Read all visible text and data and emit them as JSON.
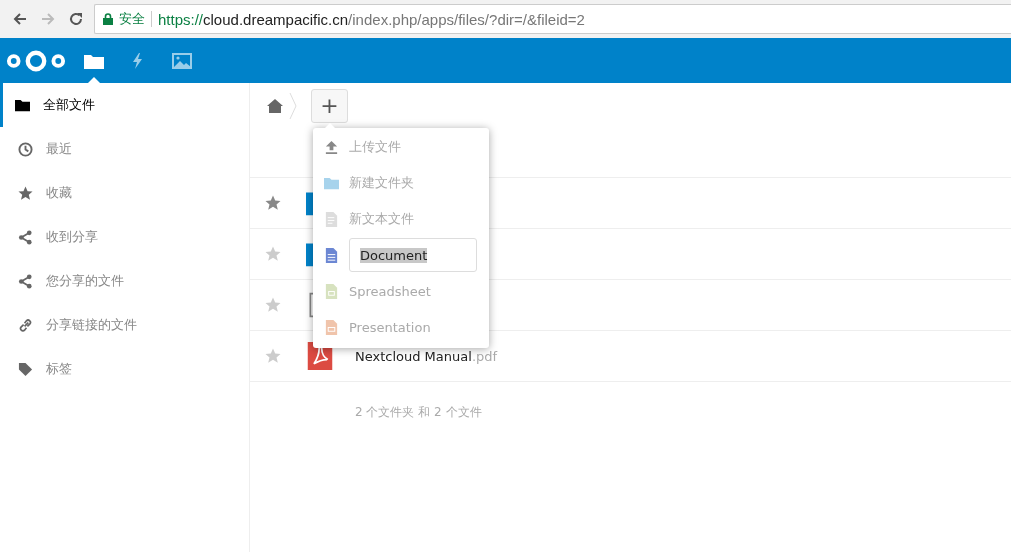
{
  "browser": {
    "secure_label": "安全",
    "url_scheme": "https://",
    "url_host": "cloud.dreampacific.cn",
    "url_path": "/index.php/apps/files/?dir=/&fileid=2"
  },
  "header": {
    "apps": [
      {
        "kind": "files",
        "selected": true
      },
      {
        "kind": "activity",
        "selected": false
      },
      {
        "kind": "gallery",
        "selected": false
      }
    ]
  },
  "sidebar": {
    "items": [
      {
        "kind": "folder",
        "label": "全部文件",
        "selected": true
      },
      {
        "kind": "clock",
        "label": "最近",
        "selected": false
      },
      {
        "kind": "star",
        "label": "收藏",
        "selected": false
      },
      {
        "kind": "share",
        "label": "收到分享",
        "selected": false
      },
      {
        "kind": "share",
        "label": "您分享的文件",
        "selected": false
      },
      {
        "kind": "link",
        "label": "分享链接的文件",
        "selected": false
      },
      {
        "kind": "tag",
        "label": "标签",
        "selected": false
      }
    ]
  },
  "breadcrumb": {
    "add_button": "+"
  },
  "new_menu": {
    "items": [
      {
        "kind": "upload",
        "label": "上传文件"
      },
      {
        "kind": "folder",
        "label": "新建文件夹"
      },
      {
        "kind": "text",
        "label": "新文本文件"
      },
      {
        "kind": "document",
        "value": "Document",
        "editing": true
      },
      {
        "kind": "spreadsheet",
        "label": "Spreadsheet"
      },
      {
        "kind": "presentation",
        "label": "Presentation"
      }
    ]
  },
  "files": [
    {
      "kind": "folder",
      "favorite": true
    },
    {
      "kind": "folder",
      "favorite": false
    },
    {
      "kind": "text",
      "favorite": false
    },
    {
      "kind": "pdf",
      "favorite": false,
      "name": "Nextcloud Manual",
      "ext": ".pdf"
    }
  ],
  "summary": "2 个文件夹 和 2 个文件"
}
